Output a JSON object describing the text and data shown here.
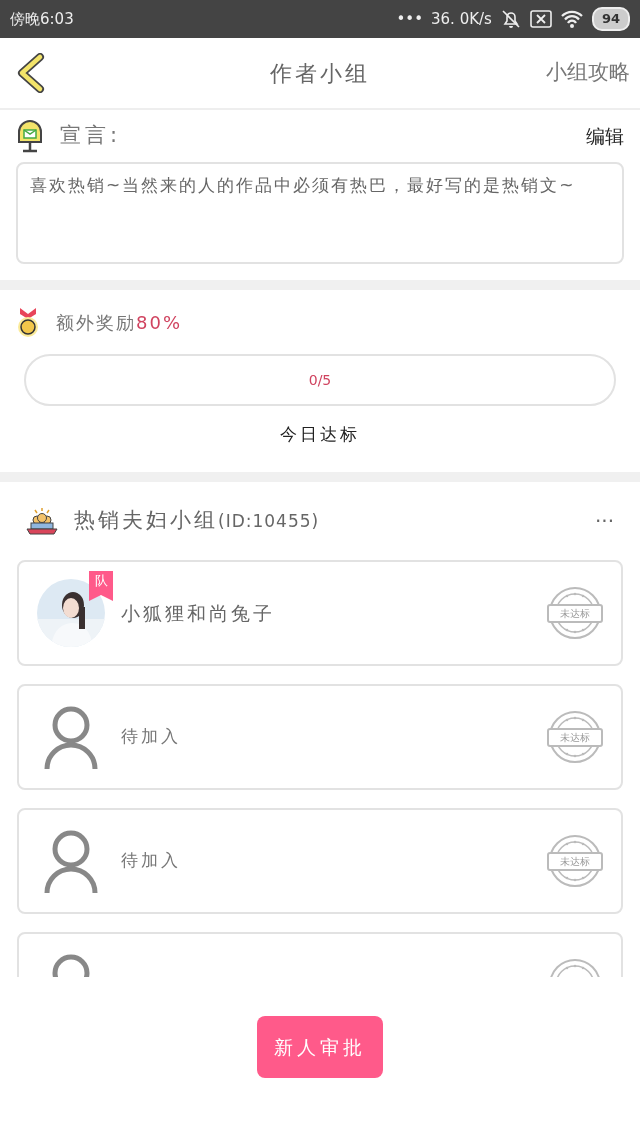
{
  "status_bar": {
    "time": "傍晚6:03",
    "dots": "•••",
    "speed": "36. 0K/s",
    "battery": "94"
  },
  "header": {
    "title": "作者小组",
    "action": "小组攻略"
  },
  "manifesto": {
    "label": "宣言:",
    "edit": "编辑",
    "text": "喜欢热销~当然来的人的作品中必须有热巴，最好写的是热销文~"
  },
  "reward": {
    "label": "额外奖励",
    "percent": "80%",
    "progress": {
      "level": 0,
      "reading": "0/5"
    },
    "caption": "今日达标"
  },
  "group": {
    "name": "热销夫妇小组",
    "id": "(ID:10455)",
    "more": "···"
  },
  "members": [
    {
      "kind": "member",
      "leader_badge": "队",
      "name": "小狐狸和尚兔子",
      "stamp": "未达标"
    },
    {
      "kind": "vacant",
      "name": "待加入",
      "stamp": "未达标"
    },
    {
      "kind": "vacant",
      "name": "待加入",
      "stamp": "未达标"
    },
    {
      "kind": "vacant"
    }
  ],
  "footer": {
    "button": "新人审批"
  }
}
